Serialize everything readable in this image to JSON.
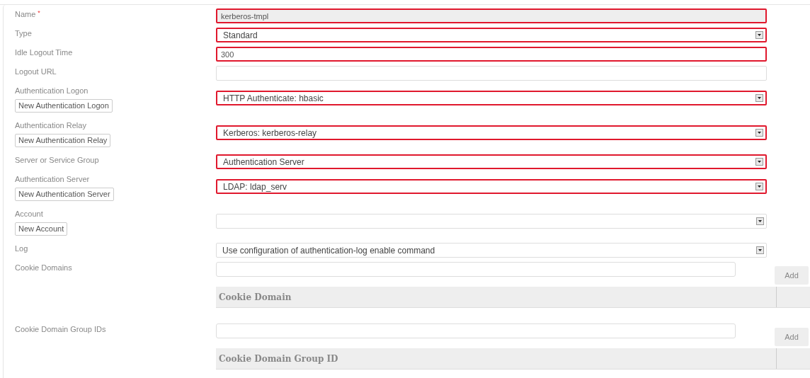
{
  "fields": [
    {
      "label": "Name",
      "required_mark": "*",
      "kind": "input",
      "value": "kerberos-tmpl",
      "disabled": true,
      "highlighted": true
    },
    {
      "label": "Type",
      "kind": "select",
      "value": "Standard",
      "highlighted": true
    },
    {
      "label": "Idle Logout Time",
      "kind": "input",
      "value": "300",
      "disabled": false,
      "highlighted": true
    },
    {
      "label": "Logout URL",
      "kind": "input",
      "disabled": false,
      "highlighted": false
    },
    {
      "label": "Authentication Logon",
      "kind": "select",
      "value": "HTTP Authenticate: hbasic",
      "highlighted": true,
      "new_button": "New Authentication Logon"
    },
    {
      "label": "Authentication Relay",
      "kind": "select",
      "value": "Kerberos: kerberos-relay",
      "highlighted": true,
      "new_button": "New Authentication Relay"
    },
    {
      "label": "Server or Service Group",
      "kind": "select",
      "value": "Authentication Server",
      "highlighted": true
    },
    {
      "label": "Authentication Server",
      "kind": "select",
      "value": "LDAP: ldap_serv",
      "highlighted": true,
      "new_button": "New Authentication Server"
    },
    {
      "label": "Account",
      "kind": "select",
      "highlighted": false,
      "new_button": "New Account"
    },
    {
      "label": "Log",
      "kind": "select",
      "value": "Use configuration of authentication-log enable command",
      "highlighted": false
    },
    {
      "label": "Cookie Domains",
      "kind": "list",
      "add_button": "Add",
      "column": "Cookie Domain"
    },
    {
      "label": "Cookie Domain Group IDs",
      "kind": "list",
      "add_button": "Add",
      "column": "Cookie Domain Group ID"
    }
  ]
}
